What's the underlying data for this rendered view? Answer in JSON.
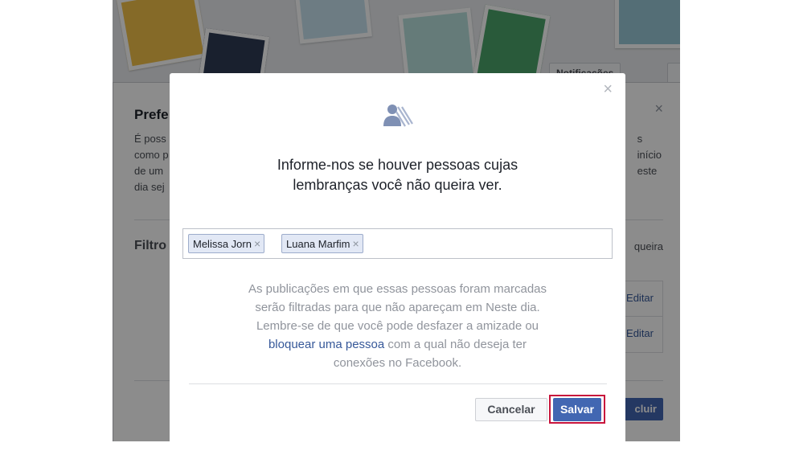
{
  "background": {
    "notifications_label": "Notificações",
    "prefs_title": "Prefe",
    "prefs_desc_lines": [
      "É poss",
      "como p",
      "de um",
      "dia sej"
    ],
    "prefs_desc_right_lines": [
      "s",
      "início",
      "este"
    ],
    "filter_label": "Filtro",
    "filter_right": "queira",
    "edit_labels": [
      "Editar",
      "Editar"
    ],
    "excluir_label": "cluir"
  },
  "modal": {
    "close_glyph": "×",
    "heading_line1": "Informe-nos se houver pessoas cujas",
    "heading_line2": "lembranças você não queira ver.",
    "tokens": [
      {
        "name": "Melissa Jorn"
      },
      {
        "name": "Luana Marfim"
      }
    ],
    "token_remove_glyph": "×",
    "info_line1": "As publicações em que essas pessoas foram marcadas",
    "info_line2": "serão filtradas para que não apareçam em Neste dia.",
    "info_line3": "Lembre-se de que você pode desfazer a amizade ou",
    "info_link": "bloquear uma pessoa",
    "info_line4_rest": " com a qual não deseja ter",
    "info_line5": "conexões no Facebook.",
    "cancel_label": "Cancelar",
    "save_label": "Salvar"
  },
  "colors": {
    "primary": "#4267b2",
    "link": "#365899",
    "highlight": "#c8143c"
  }
}
